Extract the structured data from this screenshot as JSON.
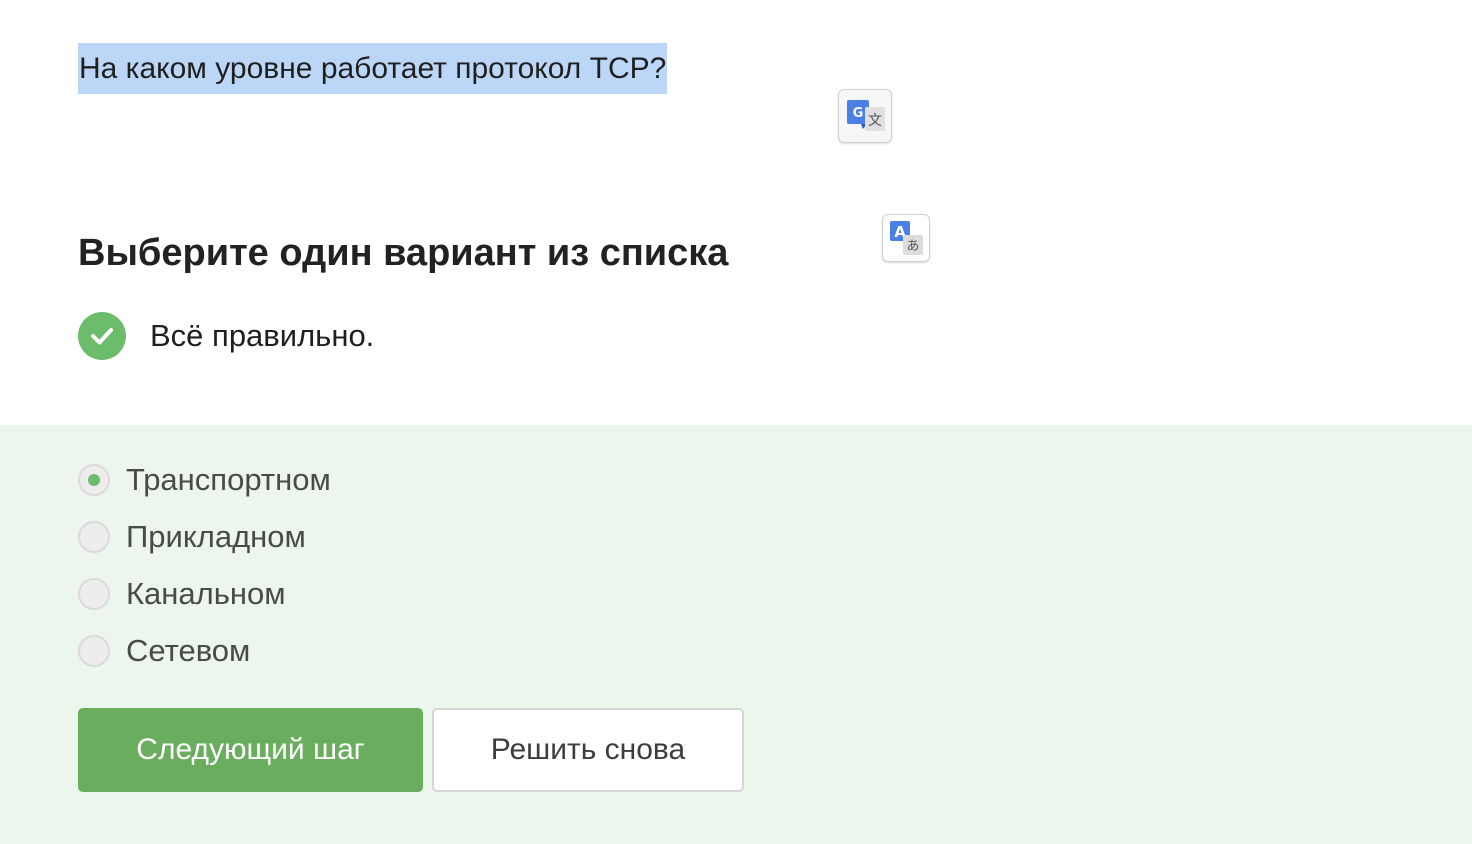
{
  "question": {
    "text": "На каком уровне работает протокол TCP?"
  },
  "translate_buttons": [
    {
      "icon": "google-translate-icon"
    },
    {
      "icon": "translate-icon"
    }
  ],
  "instruction": "Выберите один вариант из списка",
  "result": {
    "icon": "check-circle-icon",
    "text": "Всё правильно.",
    "color": "#6bbd6b"
  },
  "options": [
    {
      "label": "Транспортном",
      "selected": true
    },
    {
      "label": "Прикладном",
      "selected": false
    },
    {
      "label": "Канальном",
      "selected": false
    },
    {
      "label": "Сетевом",
      "selected": false
    }
  ],
  "buttons": {
    "next": "Следующий шаг",
    "retry": "Решить снова"
  },
  "colors": {
    "accent": "#6aad5e",
    "answer_background": "#ecf6ec",
    "selection_highlight": "#bcd6f7"
  }
}
